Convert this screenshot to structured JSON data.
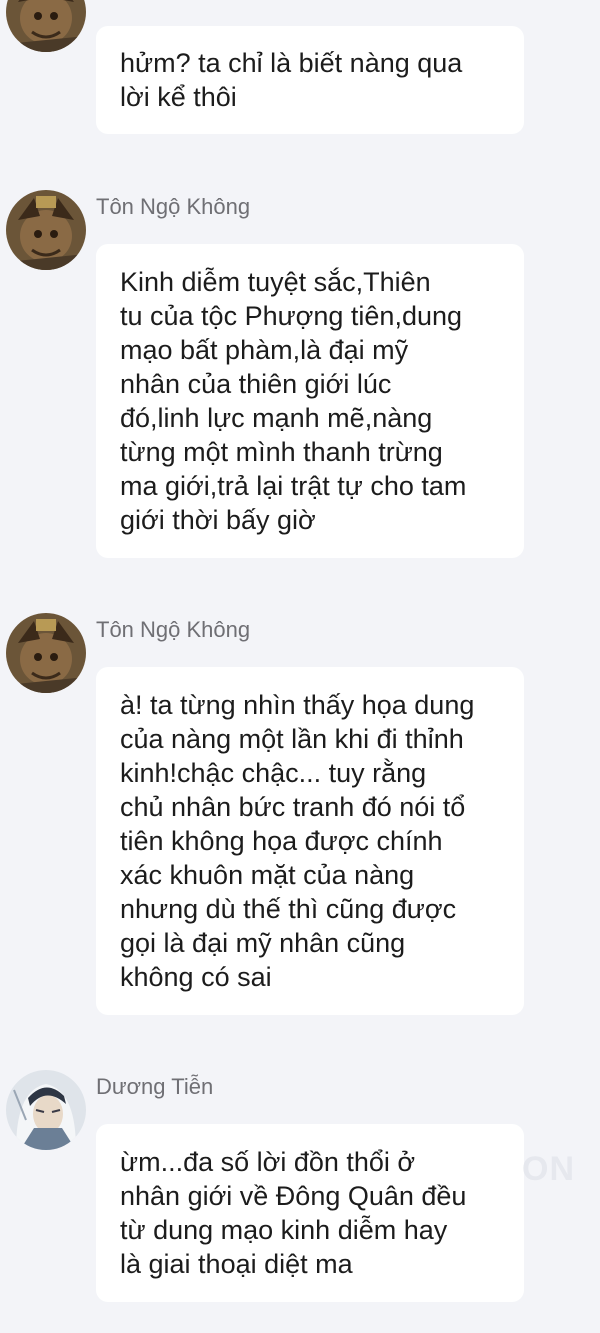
{
  "colors": {
    "background": "#f3f4f8",
    "bubble": "#ffffff",
    "sender_name": "#6f6f74",
    "message_text": "#1c1c1c"
  },
  "watermark": "ON",
  "messages": [
    {
      "sender": "",
      "avatar_icon": "monkey-king-avatar",
      "text": "hửm? ta chỉ là biết  nàng qua\nlời kể thôi"
    },
    {
      "sender": "Tôn Ngộ Không",
      "avatar_icon": "monkey-king-avatar",
      "text": "Kinh diễm tuyệt sắc,Thiên\ntu của tộc Phượng tiên,dung\nmạo bất phàm,là đại mỹ\nnhân của thiên giới lúc\nđó,linh lực mạnh mẽ,nàng\ntừng một mình thanh trừng\nma giới,trả lại trật tự cho tam\ngiới thời bấy giờ"
    },
    {
      "sender": "Tôn Ngộ Không",
      "avatar_icon": "monkey-king-avatar",
      "text": "à! ta từng nhìn thấy họa dung\ncủa nàng một lần khi đi thỉnh\nkinh!chậc chậc... tuy rằng\nchủ nhân bức tranh đó nói tổ\ntiên không họa được chính\nxác khuôn mặt của nàng\nnhưng dù thế thì cũng được\ngọi là đại mỹ nhân cũng\nkhông có sai"
    },
    {
      "sender": "Dương Tiễn",
      "avatar_icon": "white-haired-man-avatar",
      "text": "ừm...đa số lời đồn thổi ở\nnhân giới về Đông Quân đều\ntừ dung mạo kinh diễm hay\nlà giai thoại diệt ma"
    }
  ]
}
